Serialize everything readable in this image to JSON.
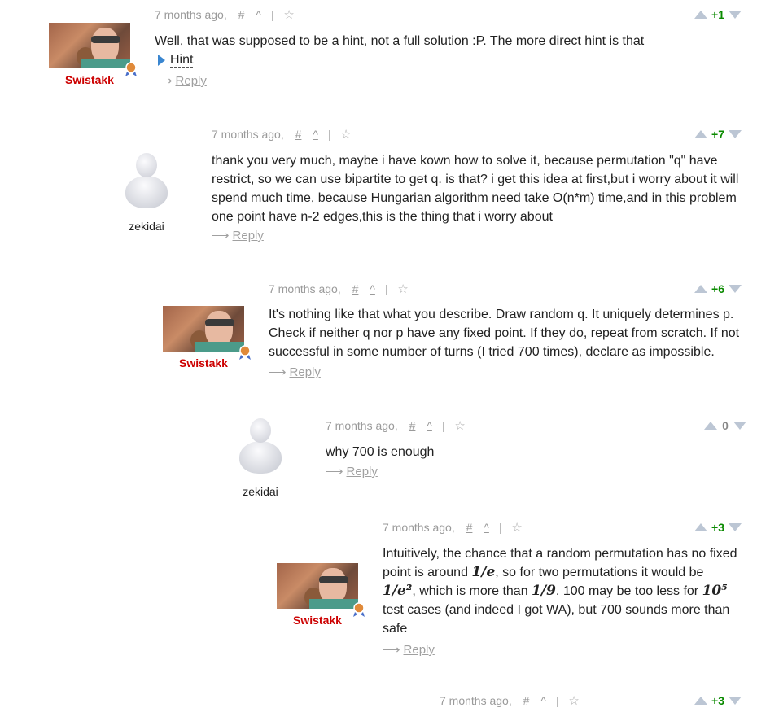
{
  "comments": [
    {
      "user": "Swistakk",
      "time": "7 months ago,",
      "hash": "#",
      "up": "^",
      "sep": "|",
      "score": "+1",
      "text_line1": "Well, that was supposed to be a hint, not a full solution :P. The more direct hint is that",
      "hint_label": "Hint",
      "reply": "Reply"
    },
    {
      "user": "zekidai",
      "time": "7 months ago,",
      "hash": "#",
      "up": "^",
      "sep": "|",
      "score": "+7",
      "text": "thank you very much, maybe i have kown how to solve it, because permutation \"q\" have restrict, so we can use bipartite to get q. is that? i get this idea at first,but i worry about it will spend much time, because Hungarian algorithm need take O(n*m) time,and in this problem one point have n-2 edges,this is the thing that i worry about",
      "reply": "Reply"
    },
    {
      "user": "Swistakk",
      "time": "7 months ago,",
      "hash": "#",
      "up": "^",
      "sep": "|",
      "score": "+6",
      "text": "It's nothing like that what you describe. Draw random q. It uniquely determines p. Check if neither q nor p have any fixed point. If they do, repeat from scratch. If not successful in some number of turns (I tried 700 times), declare as impossible.",
      "reply": "Reply"
    },
    {
      "user": "zekidai",
      "time": "7 months ago,",
      "hash": "#",
      "up": "^",
      "sep": "|",
      "score": "0",
      "text": "why 700 is enough",
      "reply": "Reply"
    },
    {
      "user": "Swistakk",
      "time": "7 months ago,",
      "hash": "#",
      "up": "^",
      "sep": "|",
      "score": "+3",
      "t1": "Intuitively, the chance that a random permutation has no fixed",
      "t2": "point is around ",
      "m1": "1/e",
      "t3": ", so for two permutations it would be",
      "m2": "1/e²",
      "t4": ", which is more than ",
      "m3": "1/9",
      "t5": ". 100 may be too less for ",
      "m4": "10⁵",
      "t6": "test cases (and indeed I got WA), but 700 sounds more than",
      "t7": "safe",
      "reply": "Reply"
    },
    {
      "time": "7 months ago,",
      "hash": "#",
      "up": "^",
      "sep": "|",
      "score": "+3"
    }
  ],
  "colors": {
    "score_positive": "#0a8a00",
    "username_red": "#cc0000",
    "meta": "#9a9a9a"
  },
  "icons": [
    "star-icon",
    "vote-up-icon",
    "vote-down-icon",
    "badge-icon",
    "hint-triangle-icon",
    "reply-arrow-icon"
  ]
}
